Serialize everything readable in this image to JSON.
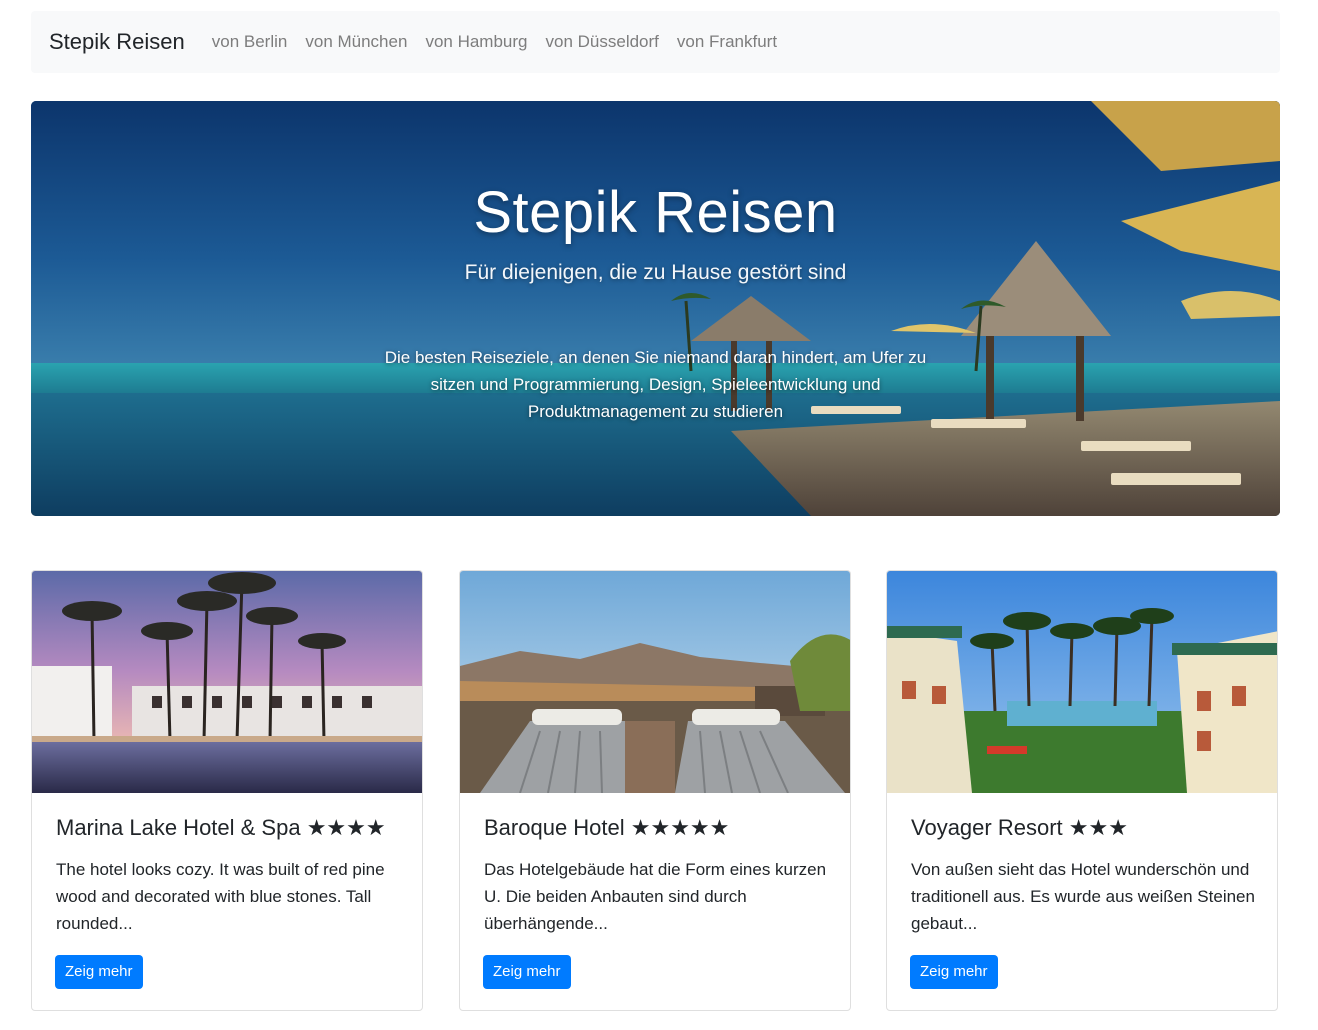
{
  "navbar": {
    "brand": "Stepik Reisen",
    "links": [
      "von Berlin",
      "von München",
      "von Hamburg",
      "von Düsseldorf",
      "von Frankfurt"
    ]
  },
  "hero": {
    "title": "Stepik Reisen",
    "subtitle": "Für diejenigen, die zu Hause gestört sind",
    "text": "Die besten Reiseziele, an denen Sie niemand daran hindert, am Ufer zu sitzen und Programmierung, Design, Spieleentwicklung und Produktmanagement zu studieren"
  },
  "cards": [
    {
      "title": "Marina Lake Hotel & Spa ★★★★",
      "text": "The hotel looks cozy. It was built of red pine wood and decorated with blue stones. Tall rounded...",
      "button": "Zeig mehr"
    },
    {
      "title": "Baroque Hotel ★★★★★",
      "text": "Das Hotelgebäude hat die Form eines kurzen U. Die beiden Anbauten sind durch überhängende...",
      "button": "Zeig mehr"
    },
    {
      "title": "Voyager Resort ★★★",
      "text": "Von außen sieht das Hotel wunderschön und traditionell aus. Es wurde aus weißen Steinen gebaut...",
      "button": "Zeig mehr"
    }
  ],
  "colors": {
    "primary": "#007bff",
    "navbar_bg": "#f8f9fa",
    "text": "#212529",
    "nav_link": "#7d7d7d"
  }
}
